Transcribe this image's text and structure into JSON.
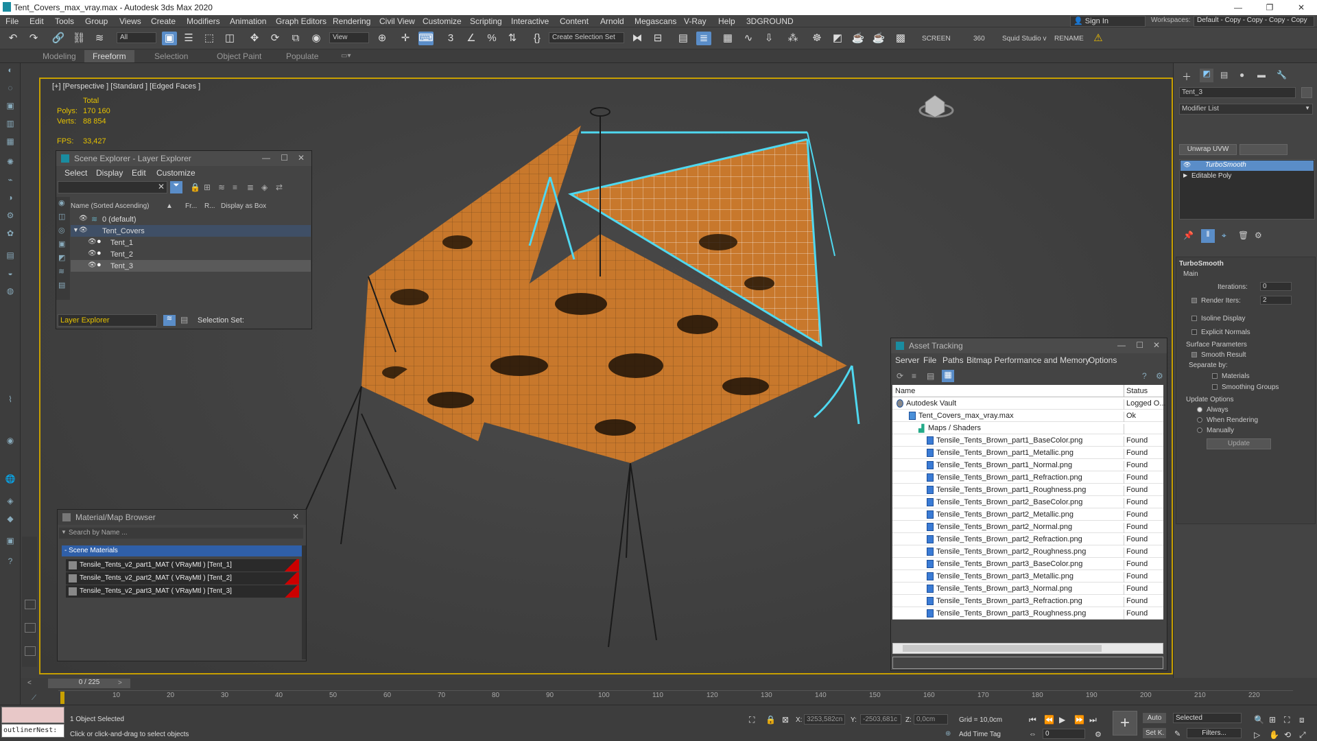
{
  "window": {
    "title": "Tent_Covers_max_vray.max - Autodesk 3ds Max 2020",
    "minimize": "—",
    "maximize": "❐",
    "close": "✕"
  },
  "menu": [
    "File",
    "Edit",
    "Tools",
    "Group",
    "Views",
    "Create",
    "Modifiers",
    "Animation",
    "Graph Editors",
    "Rendering",
    "Civil View",
    "Customize",
    "Scripting",
    "Interactive",
    "Content",
    "Arnold",
    "Megascans",
    "V-Ray",
    "Help",
    "3DGROUND"
  ],
  "signin": "Sign In",
  "workspaces": {
    "label": "Workspaces:",
    "value": "Default - Copy - Copy - Copy - Copy"
  },
  "toolbar": {
    "filter": "All",
    "view": "View",
    "selset": "Create Selection Set",
    "screen": "SCREEN",
    "num360": "360",
    "squid": "Squid Studio v",
    "rename": "RENAME"
  },
  "ribbon": [
    "Modeling",
    "Freeform",
    "Selection",
    "Object Paint",
    "Populate"
  ],
  "viewport": {
    "label": "[+] [Perspective ] [Standard ] [Edged Faces ]",
    "total": "Total",
    "polys_label": "Polys:",
    "polys": "170 160",
    "verts_label": "Verts:",
    "verts": "88 854",
    "fps_label": "FPS:",
    "fps": "33,427"
  },
  "scene_explorer": {
    "title": "Scene Explorer - Layer Explorer",
    "menu": [
      "Select",
      "Display",
      "Edit",
      "Customize"
    ],
    "col_name": "Name (Sorted Ascending)",
    "col_fr": "Fr...",
    "col_r": "R...",
    "col_box": "Display as Box",
    "rows": [
      "0 (default)",
      "Tent_Covers",
      "Tent_1",
      "Tent_2",
      "Tent_3"
    ],
    "footer": "Layer Explorer",
    "selset": "Selection Set:"
  },
  "material_browser": {
    "title": "Material/Map Browser",
    "search": "Search by Name ...",
    "group": "- Scene Materials",
    "items": [
      "Tensile_Tents_v2_part1_MAT  ( VRayMtl )  [Tent_1]",
      "Tensile_Tents_v2_part2_MAT  ( VRayMtl )  [Tent_2]",
      "Tensile_Tents_v2_part3_MAT  ( VRayMtl )  [Tent_3]"
    ]
  },
  "asset_tracking": {
    "title": "Asset Tracking",
    "menu": [
      "Server",
      "File",
      "Paths",
      "Bitmap Performance and Memory",
      "Options"
    ],
    "col_name": "Name",
    "col_status": "Status",
    "rows": [
      {
        "name": "Autodesk Vault",
        "status": "Logged O..."
      },
      {
        "name": "Tent_Covers_max_vray.max",
        "status": "Ok"
      },
      {
        "name": "Maps / Shaders",
        "status": ""
      },
      {
        "name": "Tensile_Tents_Brown_part1_BaseColor.png",
        "status": "Found"
      },
      {
        "name": "Tensile_Tents_Brown_part1_Metallic.png",
        "status": "Found"
      },
      {
        "name": "Tensile_Tents_Brown_part1_Normal.png",
        "status": "Found"
      },
      {
        "name": "Tensile_Tents_Brown_part1_Refraction.png",
        "status": "Found"
      },
      {
        "name": "Tensile_Tents_Brown_part1_Roughness.png",
        "status": "Found"
      },
      {
        "name": "Tensile_Tents_Brown_part2_BaseColor.png",
        "status": "Found"
      },
      {
        "name": "Tensile_Tents_Brown_part2_Metallic.png",
        "status": "Found"
      },
      {
        "name": "Tensile_Tents_Brown_part2_Normal.png",
        "status": "Found"
      },
      {
        "name": "Tensile_Tents_Brown_part2_Refraction.png",
        "status": "Found"
      },
      {
        "name": "Tensile_Tents_Brown_part2_Roughness.png",
        "status": "Found"
      },
      {
        "name": "Tensile_Tents_Brown_part3_BaseColor.png",
        "status": "Found"
      },
      {
        "name": "Tensile_Tents_Brown_part3_Metallic.png",
        "status": "Found"
      },
      {
        "name": "Tensile_Tents_Brown_part3_Normal.png",
        "status": "Found"
      },
      {
        "name": "Tensile_Tents_Brown_part3_Refraction.png",
        "status": "Found"
      },
      {
        "name": "Tensile_Tents_Brown_part3_Roughness.png",
        "status": "Found"
      }
    ]
  },
  "command_panel": {
    "object_name": "Tent_3",
    "modifier_list": "Modifier List",
    "unwrap": "Unwrap UVW",
    "stack": [
      "TurboSmooth",
      "Editable Poly"
    ],
    "rollout": "TurboSmooth",
    "main": "Main",
    "iterations_label": "Iterations:",
    "iterations": "0",
    "render_iters_label": "Render Iters:",
    "render_iters": "2",
    "isoline": "Isoline Display",
    "explicit": "Explicit Normals",
    "surface": "Surface Parameters",
    "smooth": "Smooth Result",
    "separate": "Separate by:",
    "materials": "Materials",
    "smoothing": "Smoothing Groups",
    "update_opts": "Update Options",
    "always": "Always",
    "when_rendering": "When Rendering",
    "manually": "Manually",
    "update": "Update"
  },
  "timeline": {
    "frame": "0 / 225",
    "ticks": [
      "10",
      "20",
      "30",
      "40",
      "50",
      "60",
      "70",
      "80",
      "90",
      "100",
      "110",
      "120",
      "130",
      "140",
      "150",
      "160",
      "170",
      "180",
      "190",
      "200",
      "210",
      "220"
    ]
  },
  "status": {
    "maxscript": "outlinerNest:",
    "selected": "1 Object Selected",
    "prompt": "Click or click-and-drag to select objects",
    "x_label": "X:",
    "x": "3253,582cn",
    "y_label": "Y:",
    "y": "-2503,681c",
    "z_label": "Z:",
    "z": "0,0cm",
    "grid": "Grid = 10,0cm",
    "add_time_tag": "Add Time Tag",
    "frame_field": "0",
    "auto": "Auto",
    "set_key": "Set K.",
    "sel_dropdown": "Selected",
    "filters": "Filters..."
  },
  "colors": {
    "accent": "#5a8dc8",
    "selection": "#4fd8f0",
    "fabric": "#c8782c",
    "viewport_border": "#c8a000"
  }
}
